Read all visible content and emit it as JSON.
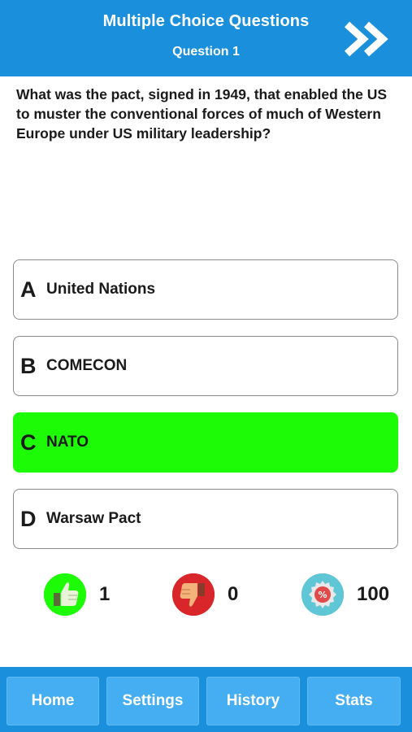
{
  "header": {
    "title": "Multiple Choice Questions",
    "subtitle": "Question 1",
    "next_icon": "double-chevron-right-icon"
  },
  "question": {
    "text": "What was the pact, signed in 1949, that enabled the US to muster the conventional forces of much of Western Europe under US military leadership?"
  },
  "options": [
    {
      "letter": "A",
      "text": "United Nations",
      "selected": false
    },
    {
      "letter": "B",
      "text": "COMECON",
      "selected": false
    },
    {
      "letter": "C",
      "text": "NATO",
      "selected": true
    },
    {
      "letter": "D",
      "text": "Warsaw Pact",
      "selected": false
    }
  ],
  "stats": {
    "correct": {
      "icon": "thumbs-up-icon",
      "value": "1",
      "color": "#1dfc06"
    },
    "wrong": {
      "icon": "thumbs-down-icon",
      "value": "0",
      "color": "#d9262a"
    },
    "percent": {
      "icon": "percent-badge-icon",
      "value": "100",
      "color": "#5fc6d6"
    }
  },
  "tabs": [
    {
      "label": "Home"
    },
    {
      "label": "Settings"
    },
    {
      "label": "History"
    },
    {
      "label": "Stats"
    }
  ],
  "colors": {
    "primary": "#1a8fdc",
    "tab_button": "#45aef2",
    "selected_option": "#1dfc06"
  }
}
